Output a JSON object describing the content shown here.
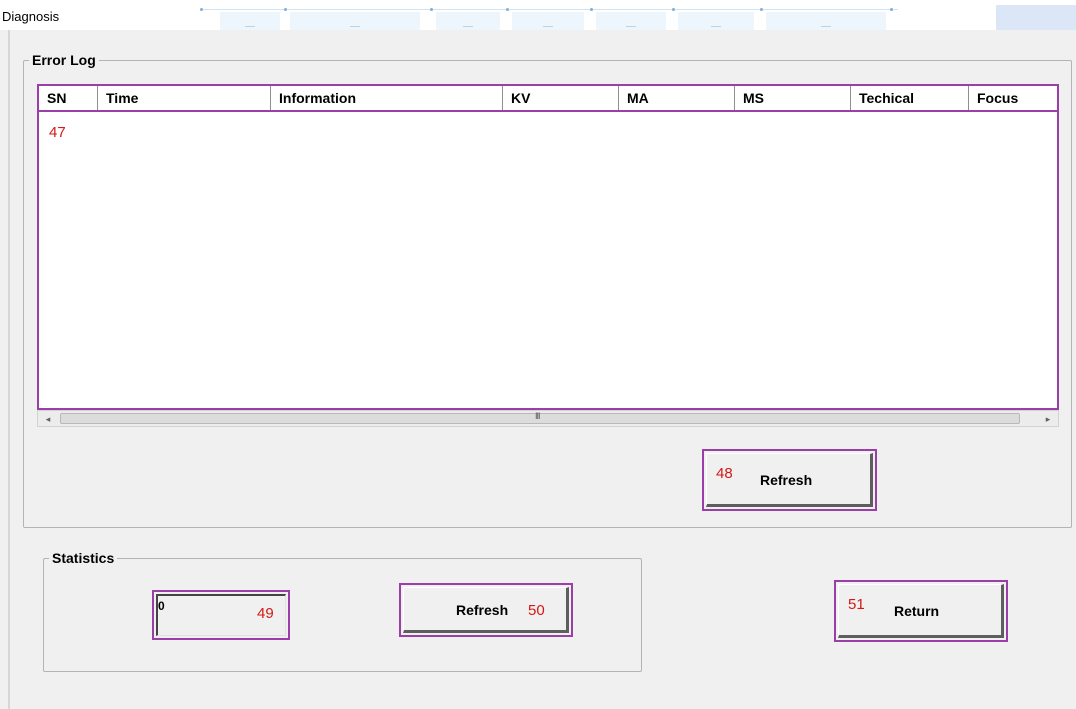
{
  "window": {
    "title": "Diagnosis"
  },
  "error_log": {
    "legend": "Error Log",
    "columns": [
      "SN",
      "Time",
      "Information",
      "KV",
      "MA",
      "MS",
      "Techical",
      "Focus"
    ],
    "list_marker": "47",
    "refresh_label": "Refresh",
    "refresh_marker": "48"
  },
  "statistics": {
    "legend": "Statistics",
    "count_value": "0",
    "count_marker": "49",
    "refresh_label": "Refresh",
    "refresh_marker": "50"
  },
  "return_button": {
    "label": "Return",
    "marker": "51"
  },
  "scrollbar": {
    "left_arrow": "◂",
    "right_arrow": "▸",
    "grip": "III"
  }
}
